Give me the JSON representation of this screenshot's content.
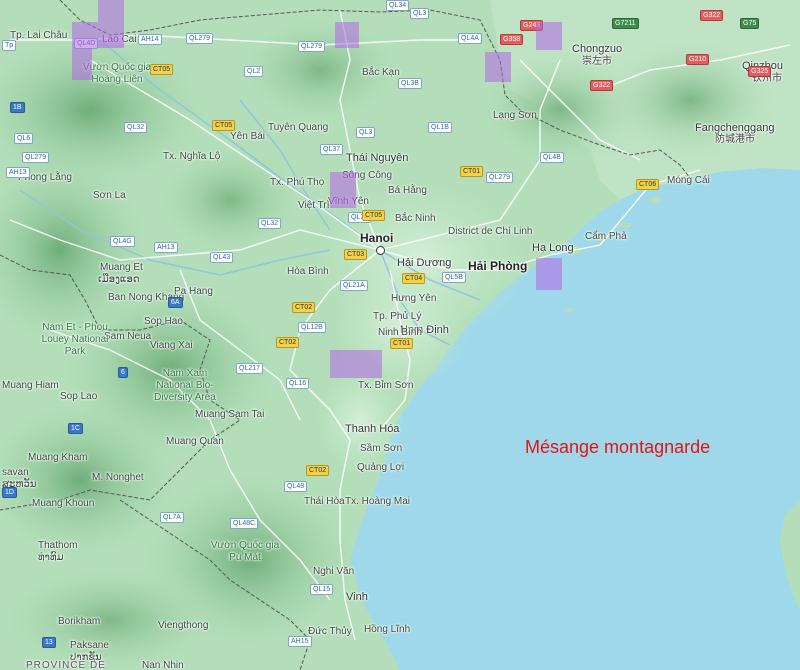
{
  "map": {
    "title": "Mésange montagnarde",
    "title_color": "#e41414",
    "cell_color": "#b266e6",
    "sea_color": "#9fd8ea",
    "land_color": "#a8d9b0",
    "cities": [
      {
        "name": "Hanoi",
        "style": "big"
      },
      {
        "name": "Hải Phòng",
        "style": "big"
      },
      {
        "name": "Thái Nguyên",
        "style": "mid"
      },
      {
        "name": "Hạ Long",
        "style": "mid"
      },
      {
        "name": "Hải Dương",
        "style": "mid"
      },
      {
        "name": "Nam Định",
        "style": "mid"
      },
      {
        "name": "Thanh Hóa",
        "style": "mid"
      },
      {
        "name": "Vinh",
        "style": "mid"
      },
      {
        "name": "Chongzuo",
        "style": "mid"
      },
      {
        "name": "崇左市",
        "style": "chinese"
      },
      {
        "name": "Fangchenggang",
        "style": "mid"
      },
      {
        "name": "防城港市",
        "style": "chinese"
      },
      {
        "name": "Qinzhou",
        "style": "mid"
      },
      {
        "name": "钦州市",
        "style": "chinese"
      },
      {
        "name": "Lào Cai",
        "style": "small"
      },
      {
        "name": "Tp. Lai Châu",
        "style": "small"
      },
      {
        "name": "Bắc Kạn",
        "style": "small"
      },
      {
        "name": "Tuyên Quang",
        "style": "small"
      },
      {
        "name": "Yên Bái",
        "style": "small"
      },
      {
        "name": "Tx. Nghĩa Lộ",
        "style": "small"
      },
      {
        "name": "Lạng Sơn",
        "style": "small"
      },
      {
        "name": "Sông Công",
        "style": "small"
      },
      {
        "name": "Tx. Phú Thọ",
        "style": "small"
      },
      {
        "name": "Bá Hằng",
        "style": "small"
      },
      {
        "name": "Vĩnh Yên",
        "style": "small"
      },
      {
        "name": "Việt Trì",
        "style": "small"
      },
      {
        "name": "Bắc Ninh",
        "style": "small"
      },
      {
        "name": "District de Chí Linh",
        "style": "small"
      },
      {
        "name": "Cẩm Phả",
        "style": "small"
      },
      {
        "name": "Móng Cái",
        "style": "small"
      },
      {
        "name": "Phong Lằng",
        "style": "small"
      },
      {
        "name": "Sơn La",
        "style": "small"
      },
      {
        "name": "Hòa Bình",
        "style": "small"
      },
      {
        "name": "Hưng Yên",
        "style": "small"
      },
      {
        "name": "Tp. Phủ Lý",
        "style": "small"
      },
      {
        "name": "Ninh Bình",
        "style": "small"
      },
      {
        "name": "Tx. Bỉm Sơn",
        "style": "small"
      },
      {
        "name": "Sầm Sơn",
        "style": "small"
      },
      {
        "name": "Quảng Lợi",
        "style": "small"
      },
      {
        "name": "Thái Hòa",
        "style": "small"
      },
      {
        "name": "Tx. Hoàng Mai",
        "style": "small"
      },
      {
        "name": "Nghi Văn",
        "style": "small"
      },
      {
        "name": "Hồng Lĩnh",
        "style": "small"
      },
      {
        "name": "Đức Thủy",
        "style": "small"
      },
      {
        "name": "Muang Et",
        "style": "small"
      },
      {
        "name": "ເມືອງແອດ",
        "style": "small"
      },
      {
        "name": "Ban Nong Khang",
        "style": "small"
      },
      {
        "name": "Pa Hang",
        "style": "small"
      },
      {
        "name": "Sop Hao",
        "style": "small"
      },
      {
        "name": "Sam Neua",
        "style": "small"
      },
      {
        "name": "Viang Xai",
        "style": "small"
      },
      {
        "name": "Muang Hiam",
        "style": "small"
      },
      {
        "name": "Sop Lao",
        "style": "small"
      },
      {
        "name": "Muang Sam Tai",
        "style": "small"
      },
      {
        "name": "Muang Quan",
        "style": "small"
      },
      {
        "name": "Muang Kham",
        "style": "small"
      },
      {
        "name": "M. Nonghet",
        "style": "small"
      },
      {
        "name": "Muang Khoun",
        "style": "small"
      },
      {
        "name": "Thathom",
        "style": "small"
      },
      {
        "name": "ທ່າທົມ",
        "style": "small"
      },
      {
        "name": "Viengthong",
        "style": "small"
      },
      {
        "name": "Borikham",
        "style": "small"
      },
      {
        "name": "Paksane",
        "style": "small"
      },
      {
        "name": "ປາກຊັນ",
        "style": "small"
      },
      {
        "name": "Nan Nhin",
        "style": "small"
      },
      {
        "name": "savan",
        "style": "small"
      },
      {
        "name": "ສະຫວັນ",
        "style": "small"
      }
    ],
    "parks": [
      "Vườn Quốc gia Hoàng Liên",
      "Nam Et - Phou Louey National Park",
      "Nam Xam National Bio-Diversity Area",
      "Vườn Quốc gia Pù Mát"
    ],
    "countries": [
      "PROVINCE DE"
    ],
    "roads": [
      {
        "ref": "QL4D",
        "kind": "nat"
      },
      {
        "ref": "AH14",
        "kind": "nat"
      },
      {
        "ref": "QL279",
        "kind": "nat"
      },
      {
        "ref": "QL279",
        "kind": "nat"
      },
      {
        "ref": "QL3",
        "kind": "nat"
      },
      {
        "ref": "QL4A",
        "kind": "nat"
      },
      {
        "ref": "QL3B",
        "kind": "nat"
      },
      {
        "ref": "QL2",
        "kind": "nat"
      },
      {
        "ref": "CT05",
        "kind": "prov"
      },
      {
        "ref": "QL32",
        "kind": "nat"
      },
      {
        "ref": "CT05",
        "kind": "prov"
      },
      {
        "ref": "QL3",
        "kind": "nat"
      },
      {
        "ref": "QL1B",
        "kind": "nat"
      },
      {
        "ref": "QL6",
        "kind": "nat"
      },
      {
        "ref": "QL279",
        "kind": "nat"
      },
      {
        "ref": "AH13",
        "kind": "nat"
      },
      {
        "ref": "QL37",
        "kind": "nat"
      },
      {
        "ref": "CT01",
        "kind": "prov"
      },
      {
        "ref": "QL279",
        "kind": "nat"
      },
      {
        "ref": "QL4B",
        "kind": "nat"
      },
      {
        "ref": "CT06",
        "kind": "prov"
      },
      {
        "ref": "QL37",
        "kind": "nat"
      },
      {
        "ref": "QL32",
        "kind": "nat"
      },
      {
        "ref": "CT05",
        "kind": "prov"
      },
      {
        "ref": "QL4G",
        "kind": "nat"
      },
      {
        "ref": "AH13",
        "kind": "nat"
      },
      {
        "ref": "QL43",
        "kind": "nat"
      },
      {
        "ref": "CT03",
        "kind": "prov"
      },
      {
        "ref": "CT04",
        "kind": "prov"
      },
      {
        "ref": "QL5B",
        "kind": "nat"
      },
      {
        "ref": "QL21A",
        "kind": "nat"
      },
      {
        "ref": "6A",
        "kind": "la"
      },
      {
        "ref": "CT02",
        "kind": "prov"
      },
      {
        "ref": "QL12B",
        "kind": "nat"
      },
      {
        "ref": "CT02",
        "kind": "prov"
      },
      {
        "ref": "CT01",
        "kind": "prov"
      },
      {
        "ref": "QL217",
        "kind": "nat"
      },
      {
        "ref": "6",
        "kind": "la"
      },
      {
        "ref": "QL16",
        "kind": "nat"
      },
      {
        "ref": "1C",
        "kind": "la"
      },
      {
        "ref": "CT02",
        "kind": "prov"
      },
      {
        "ref": "QL48",
        "kind": "nat"
      },
      {
        "ref": "QL7A",
        "kind": "nat"
      },
      {
        "ref": "QL48C",
        "kind": "nat"
      },
      {
        "ref": "QL15",
        "kind": "nat"
      },
      {
        "ref": "AH15",
        "kind": "nat"
      },
      {
        "ref": "13",
        "kind": "la"
      },
      {
        "ref": "1D",
        "kind": "la"
      },
      {
        "ref": "G243",
        "kind": "cn"
      },
      {
        "ref": "G358",
        "kind": "cn"
      },
      {
        "ref": "G7211",
        "kind": "cng"
      },
      {
        "ref": "G322",
        "kind": "cn"
      },
      {
        "ref": "G75",
        "kind": "cng"
      },
      {
        "ref": "G210",
        "kind": "cn"
      },
      {
        "ref": "G325",
        "kind": "cn"
      },
      {
        "ref": "G322",
        "kind": "cn"
      },
      {
        "ref": "1B",
        "kind": "la"
      },
      {
        "ref": "QL6",
        "kind": "nat"
      },
      {
        "ref": "QL34",
        "kind": "nat"
      },
      {
        "ref": "QL3",
        "kind": "nat"
      },
      {
        "ref": "QL4A",
        "kind": "nat"
      },
      {
        "ref": "Tp",
        "kind": "nat"
      }
    ],
    "occurrence_cells_count_hint": "purple grid cells mark observations"
  }
}
